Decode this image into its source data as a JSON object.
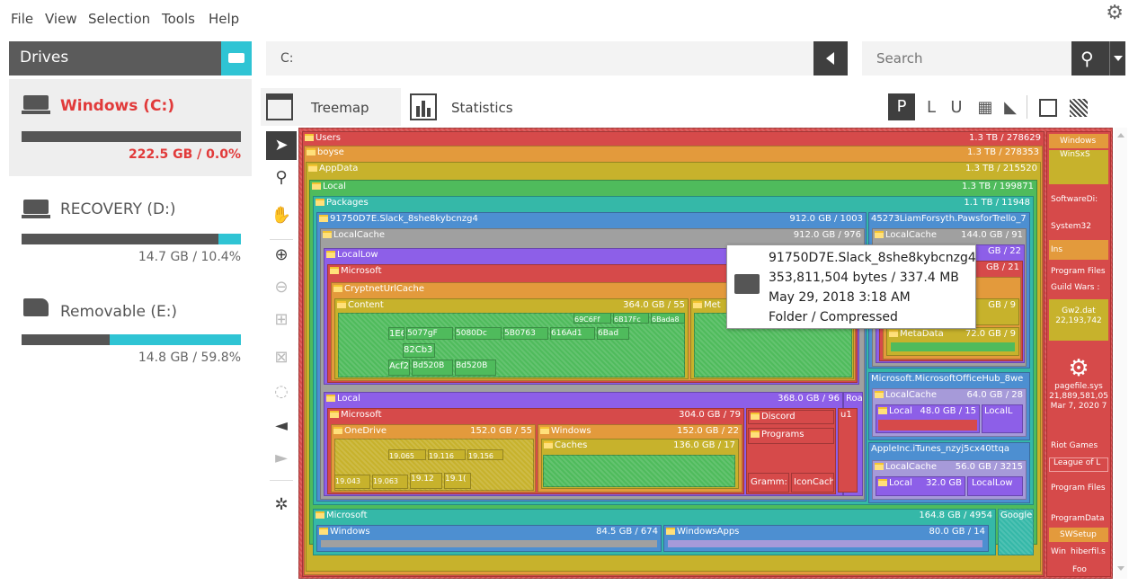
{
  "menu": [
    "File",
    "View",
    "Selection",
    "Tools",
    "Help"
  ],
  "drives_panel": {
    "title": "Drives",
    "drives": [
      {
        "name": "Windows (C:)",
        "size": "222.5 GB  /  0.0%",
        "free_fraction": 0.0,
        "selected": true
      },
      {
        "name": "RECOVERY (D:)",
        "size": "14.7 GB  /  10.4%",
        "free_fraction": 0.104,
        "selected": false
      },
      {
        "name": "Removable (E:)",
        "size": "14.8 GB  /  59.8%",
        "free_fraction": 0.598,
        "selected": false
      }
    ]
  },
  "path": {
    "value": "C:"
  },
  "search": {
    "placeholder": "Search"
  },
  "tabs": {
    "treemap": "Treemap",
    "statistics": "Statistics"
  },
  "size_modes": [
    "P",
    "L",
    "U"
  ],
  "treemap": {
    "users": {
      "name": "Users",
      "size": "1.3 TB / 278629"
    },
    "boyse": {
      "name": "boyse",
      "size": "1.3 TB / 278353"
    },
    "appdata": {
      "name": "AppData",
      "size": "1.3 TB / 215520"
    },
    "local": {
      "name": "Local",
      "size": "1.3 TB / 199871"
    },
    "packages": {
      "name": "Packages",
      "size": "1.1 TB / 11948"
    },
    "slack": {
      "name": "91750D7E.Slack_8she8kybcnzg4",
      "size": "912.0 GB / 1003"
    },
    "slack_localcache": {
      "name": "LocalCache",
      "size": "912.0 GB / 976"
    },
    "localcache_localow": {
      "name": "LocalLow"
    },
    "microsoft1": {
      "name": "Microsoft"
    },
    "cryptnet": {
      "name": "CryptnetUrlCache"
    },
    "content": {
      "name": "Content",
      "size": "364.0 GB / 55"
    },
    "meta_short": {
      "name": "Met"
    },
    "content_files": [
      "69C6Ff",
      "6B17Fc",
      "6Bada8",
      "1E6£",
      "5077gF",
      "5080Dc",
      "5B0763",
      "616Ad1",
      "6Bad",
      "82Cb3",
      "Acf2",
      "Bd520B",
      "Bd520B"
    ],
    "local2": {
      "name": "Local",
      "size": "368.0 GB / 96"
    },
    "roa": {
      "name": "Roa"
    },
    "u1": {
      "name": "u1"
    },
    "microsoft2": {
      "name": "Microsoft",
      "size": "304.0 GB / 79"
    },
    "onedrive": {
      "name": "OneDrive",
      "size": "152.0 GB / 55"
    },
    "onedrive_files": [
      "19.065",
      "19.116",
      "19.156",
      "19.043",
      "19.063",
      "19.12",
      "19.1("
    ],
    "windows_sub": {
      "name": "Windows",
      "size": "152.0 GB / 22"
    },
    "caches": {
      "name": "Caches",
      "size": "136.0 GB / 17"
    },
    "discord": {
      "name": "Discord"
    },
    "programs": {
      "name": "Programs"
    },
    "grammarly": {
      "name": "Gramm:"
    },
    "iconcache": {
      "name": "IconCach"
    },
    "pawsfortrello": {
      "name": "45273LiamForsyth.PawsforTrello_7"
    },
    "paws_localcache": {
      "name": "LocalCache",
      "size": "144.0 GB / 91"
    },
    "paws_a": {
      "size": "GB / 22"
    },
    "paws_b": {
      "size": "GB / 21"
    },
    "paws_c": {
      "size": "GB / 9"
    },
    "metadata": {
      "name": "MetaData",
      "size": "72.0 GB / 9"
    },
    "officehub": {
      "name": "Microsoft.MicrosoftOfficeHub_8we"
    },
    "officehub_localcache": {
      "name": "LocalCache",
      "size": "64.0 GB / 28"
    },
    "officehub_local": {
      "name": "Local",
      "size": "48.0 GB / 15"
    },
    "officehub_locala": {
      "name": "LocalL"
    },
    "itunes": {
      "name": "AppleInc.iTunes_nzyj5cx40ttqa"
    },
    "itunes_localcache": {
      "name": "LocalCache",
      "size": "56.0 GB / 3215"
    },
    "itunes_local": {
      "name": "Local",
      "size": "32.0 GB"
    },
    "itunes_locallow": {
      "name": "LocalLow"
    },
    "microsoft3": {
      "name": "Microsoft",
      "size": "164.8 GB / 4954"
    },
    "google": {
      "name": "Google"
    },
    "windows3": {
      "name": "Windows",
      "size": "84.5 GB / 674"
    },
    "windowsapps": {
      "name": "WindowsApps",
      "size": "80.0 GB / 14"
    }
  },
  "right_strip": {
    "windows": "Windows",
    "winsxs": "WinSxS",
    "softwaredist": "SoftwareDi:",
    "system32": "System32",
    "ins": "Ins",
    "program_files": "Program Files",
    "guild_wars": "Guild Wars :",
    "gw2_name": "Gw2.dat",
    "gw2_size": "22,193,742",
    "pagefile_name": "pagefile.sys",
    "pagefile_size": "21,889,581,05",
    "pagefile_date": "Mar 7, 2020 7",
    "riot_games": "Riot Games",
    "league": "League of L",
    "program_files2": "Program Files",
    "programdata": "ProgramData",
    "swsetup": "SWSetup",
    "win": "Win",
    "hiberfil": "hiberfil.s",
    "foo": "Foo"
  },
  "tooltip": {
    "name": "91750D7E.Slack_8she8kybcnzg4",
    "bytes": "353,811,504 bytes  /  337.4 MB",
    "date": "May 29, 2018  3:18 AM",
    "type": "Folder  /  Compressed"
  }
}
